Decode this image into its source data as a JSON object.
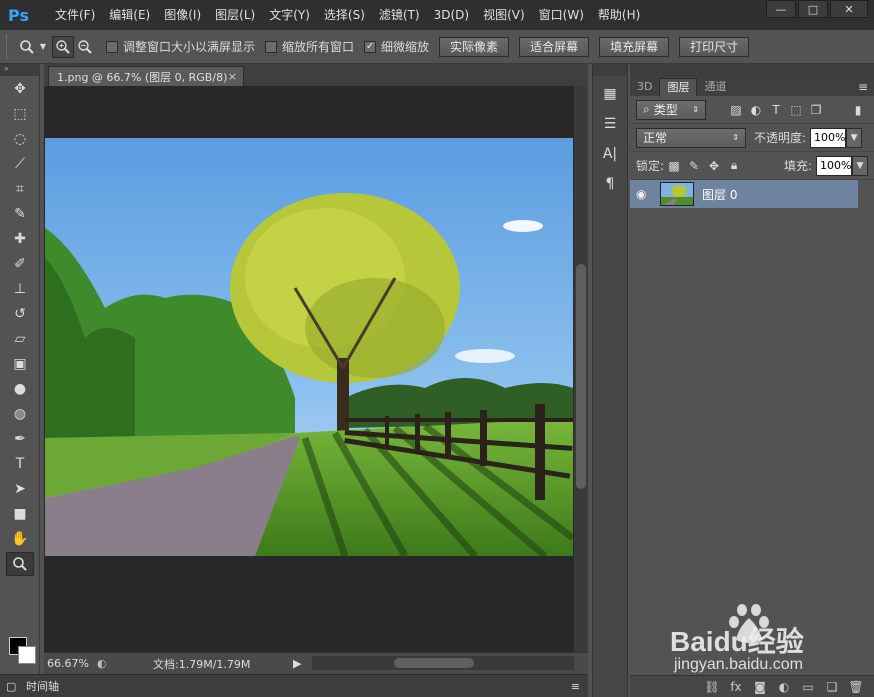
{
  "app": {
    "logo": "Ps"
  },
  "menu": [
    "文件(F)",
    "编辑(E)",
    "图像(I)",
    "图层(L)",
    "文字(Y)",
    "选择(S)",
    "滤镜(T)",
    "3D(D)",
    "视图(V)",
    "窗口(W)",
    "帮助(H)"
  ],
  "window_buttons": {
    "minimize": "—",
    "maximize": "□",
    "close": "✕"
  },
  "options": {
    "resize_windows": {
      "label": "调整窗口大小以满屏显示",
      "checked": false
    },
    "zoom_all": {
      "label": "缩放所有窗口",
      "checked": false
    },
    "scrubby_zoom": {
      "label": "细微缩放",
      "checked": true
    },
    "buttons": [
      "实际像素",
      "适合屏幕",
      "填充屏幕",
      "打印尺寸"
    ]
  },
  "document": {
    "tab_title": "1.png @ 66.7% (图层 0, RGB/8)",
    "tab_close": "×"
  },
  "status": {
    "zoom": "66.67%",
    "doc_info": "文档:1.79M/1.79M"
  },
  "timeline": {
    "label": "时间轴"
  },
  "layers_panel": {
    "tabs": [
      "3D",
      "图层",
      "通道"
    ],
    "filter_kind": "类型",
    "blend_mode": "正常",
    "opacity_label": "不透明度:",
    "opacity_value": "100%",
    "lock_label": "锁定:",
    "fill_label": "填充:",
    "fill_value": "100%",
    "layers": [
      {
        "name": "图层 0",
        "visible": true,
        "selected": true
      }
    ]
  },
  "watermark": {
    "brand": "Baidu经验",
    "url": "jingyan.baidu.com"
  },
  "colors": {
    "accent": "#31a8ff",
    "selected_layer": "#6e83a0",
    "canvas_bg": "#282828",
    "ui_bg": "#535353"
  }
}
